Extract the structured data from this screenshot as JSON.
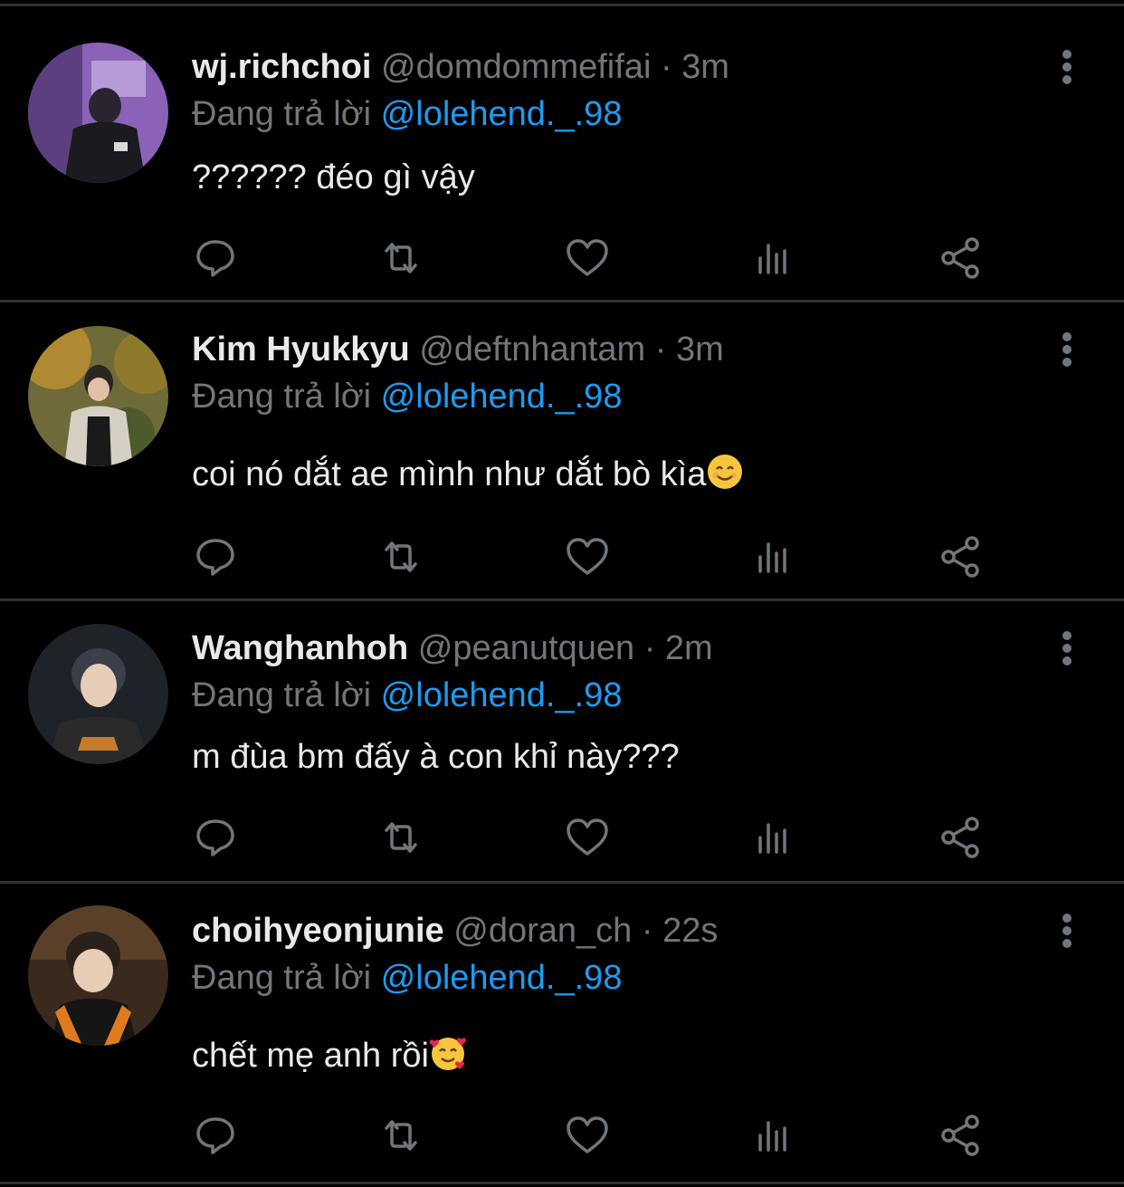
{
  "reply_prefix": "Đang trả lời",
  "colors": {
    "background": "#000000",
    "text": "#e7e9ea",
    "muted": "#71767b",
    "link": "#1d9bf0",
    "divider": "#2f3336"
  },
  "tweets": [
    {
      "name": "wj.richchoi",
      "handle": "@domdommefifai",
      "time": "3m",
      "mention": "@lolehend._.98",
      "text": "?????? đéo gì vậy",
      "emoji": ""
    },
    {
      "name": "Kim Hyukkyu",
      "handle": "@deftnhantam",
      "time": "3m",
      "mention": "@lolehend._.98",
      "text": "coi nó dắt ae mình như dắt bò kìa",
      "emoji": "smiling-face-icon"
    },
    {
      "name": "Wanghanhoh",
      "handle": "@peanutquen",
      "time": "2m",
      "mention": "@lolehend._.98",
      "text": "m đùa bm đấy à con khỉ này???",
      "emoji": ""
    },
    {
      "name": "choihyeonjunie",
      "handle": "@doran_ch",
      "time": "22s",
      "mention": "@lolehend._.98",
      "text": "chết mẹ anh rồi",
      "emoji": "smiling-face-with-hearts-icon"
    }
  ],
  "action_icons": [
    "reply-icon",
    "retweet-icon",
    "like-icon",
    "views-icon",
    "share-icon"
  ]
}
